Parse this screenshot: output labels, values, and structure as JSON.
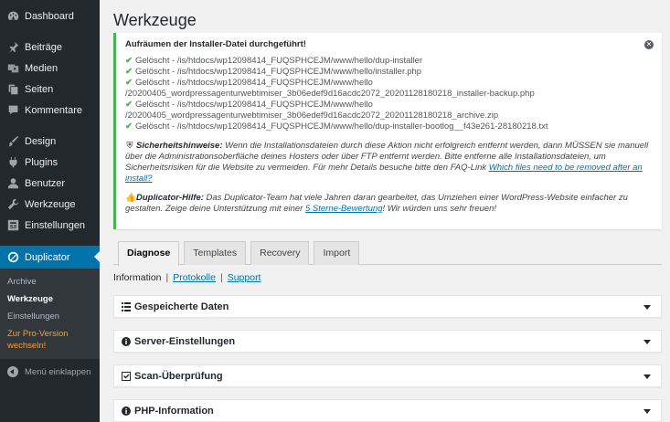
{
  "sidebar": {
    "items": [
      {
        "label": "Dashboard",
        "icon": "dashboard-icon"
      },
      {
        "label": "Beiträge",
        "icon": "pin-icon"
      },
      {
        "label": "Medien",
        "icon": "media-icon"
      },
      {
        "label": "Seiten",
        "icon": "page-icon"
      },
      {
        "label": "Kommentare",
        "icon": "comment-icon"
      },
      {
        "label": "Design",
        "icon": "brush-icon"
      },
      {
        "label": "Plugins",
        "icon": "plugin-icon"
      },
      {
        "label": "Benutzer",
        "icon": "user-icon"
      },
      {
        "label": "Werkzeuge",
        "icon": "wrench-icon"
      },
      {
        "label": "Einstellungen",
        "icon": "settings-icon"
      },
      {
        "label": "Duplicator",
        "icon": "duplicator-icon"
      }
    ],
    "submenu": [
      "Archive",
      "Werkzeuge",
      "Einstellungen",
      "Zur Pro-Version wechseln!"
    ],
    "collapse_label": "Menü einklappen"
  },
  "page": {
    "title": "Werkzeuge"
  },
  "notice": {
    "title": "Aufräumen der Installer-Datei durchgeführt!",
    "log": [
      "Gelöscht - /is/htdocs/wp12098414_FUQSPHCEJM/www/hello/dup-installer",
      "Gelöscht - /is/htdocs/wp12098414_FUQSPHCEJM/www/hello/installer.php",
      "Gelöscht - /is/htdocs/wp12098414_FUQSPHCEJM/www/hello",
      "/20200405_wordpressagenturwebtimiser_3b06edef9d16acdc2072_20201128180218_installer-backup.php",
      "Gelöscht - /is/htdocs/wp12098414_FUQSPHCEJM/www/hello",
      "/20200405_wordpressagenturwebtimiser_3b06edef9d16acdc2072_20201128180218_archive.zip",
      "Gelöscht - /is/htdocs/wp12098414_FUQSPHCEJM/www/hello/dup-installer-bootlog__f43e261-28180218.txt"
    ],
    "security_label": "Sicherheitshinweise:",
    "security_text": " Wenn die Installationsdateien durch diese Aktion nicht erfolgreich entfernt werden, dann MÜSSEN sie manuell über die Administrationsoberfläche deines Hosters oder über FTP entfernt werden. Bitte entferne alle Installationsdateien, um Sicherheitsrisiken für die Website zu vermeiden. Für mehr Details besuche bitte den FAQ-Link ",
    "security_link": "Which files need to be removed after an install?",
    "help_label": "Duplicator-Hilfe:",
    "help_text": " Das Duplicator-Team hat viele Jahren daran gearbeitet, das Umziehen einer WordPress-Website einfacher zu gestalten. Zeige deine Unterstützung mit einer ",
    "help_link": "5 Sterne-Bewertung",
    "help_after": "! Wir würden uns sehr freuen!"
  },
  "tabs": [
    "Diagnose",
    "Templates",
    "Recovery",
    "Import"
  ],
  "sublinks": {
    "current": "Information",
    "links": [
      "Protokolle",
      "Support"
    ]
  },
  "boxes": [
    "Gespeicherte Daten",
    "Server-Einstellungen",
    "Scan-Überprüfung",
    "PHP-Information"
  ],
  "colors": {
    "sidebar": "#23282d",
    "accent": "#0073aa",
    "success": "#46b450",
    "pro": "#f1a133"
  }
}
